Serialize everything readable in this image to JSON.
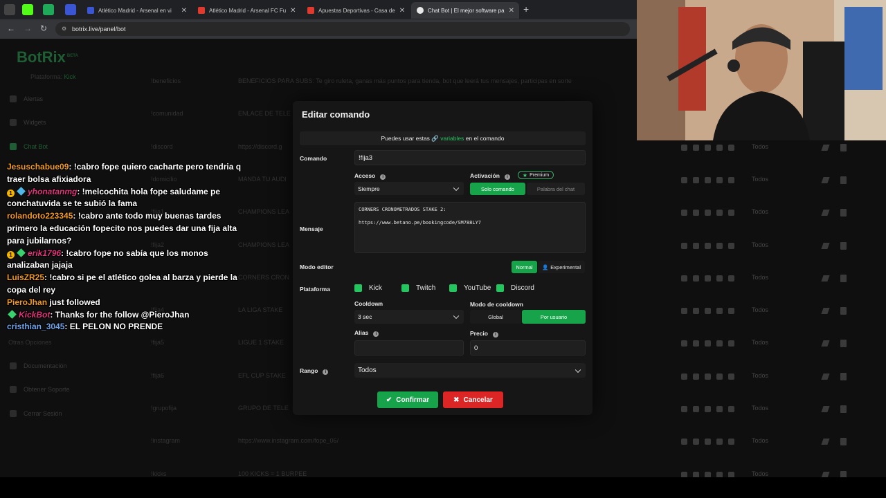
{
  "browser": {
    "tabs": [
      {
        "label": "Atlético Madrid - Arsenal en vi",
        "color": "#3a56d4"
      },
      {
        "label": "Atlético Madrid - Arsenal FC Fu",
        "color": "#e03a2f"
      },
      {
        "label": "Apuestas Deportivas - Casa de",
        "color": "#e03a2f"
      },
      {
        "label": "Chat Bot | El mejor software pa",
        "color": "#e8e8e8"
      }
    ],
    "url": "botrix.live/panel/bot"
  },
  "background": {
    "logo": "BotRix",
    "logo_badge": "BETA",
    "platform_label": "Plataforma:",
    "platform_value": "Kick",
    "sidebar": [
      {
        "label": "Alertas"
      },
      {
        "label": "Widgets"
      },
      {
        "label": "Chat Bot"
      }
    ],
    "sidebar_bottom_head": "Otras Opciones",
    "sidebar_bottom": [
      {
        "label": "Documentación"
      },
      {
        "label": "Obtener Soporte"
      },
      {
        "label": "Cerrar Sesión"
      }
    ],
    "commands": [
      {
        "name": "!beneficios",
        "text": "BENEFICIOS PARA SUBS: Te giro ruleta, ganas más puntos para tienda, bot que leerá tus mensajes, participas en sorte"
      },
      {
        "name": "!comunidad",
        "text": "ENLACE DE TELE"
      },
      {
        "name": "!discord",
        "text": "https://discord.g"
      },
      {
        "name": "!domicilio",
        "text": "MANDA TU AUDI"
      },
      {
        "name": "!fija1",
        "text": "CHAMPIONS LEA"
      },
      {
        "name": "!fija2",
        "text": "CHAMPIONS LEA"
      },
      {
        "name": "!fija3",
        "text": "CORNERS CRON"
      },
      {
        "name": "!fija4",
        "text": "LA LIGA STAKE"
      },
      {
        "name": "!fija5",
        "text": "LIGUE 1 STAKE"
      },
      {
        "name": "!fija6",
        "text": "EFL CUP STAKE"
      },
      {
        "name": "!grupofija",
        "text": "GRUPO DE TELE"
      },
      {
        "name": "!instagram",
        "text": "https://www.instagram.com/fope_06/"
      },
      {
        "name": "!kicks",
        "text": "100 KICKS = 1 BURPEE"
      }
    ],
    "rank_value": "Todos"
  },
  "chat": [
    {
      "user": "Jesuschabue09",
      "user_color": "orange",
      "badge": "",
      "msg": ": !cabro fope quiero cacharte pero tendria q traer bolsa afixiadora"
    },
    {
      "user": "yhonatanmg",
      "user_color": "pink",
      "badge": "1",
      "msg": ": !melcochita hola fope saludame pe conchatuvida se te subió la fama"
    },
    {
      "user": "rolandoto223345",
      "user_color": "orange",
      "badge": "",
      "msg": ": !cabro ante todo muy buenas tardes primero la educación fopecito nos puedes dar una fija alta para jubilarnos?"
    },
    {
      "user": "erik1796",
      "user_color": "pink",
      "badge": "1",
      "msg": ": !cabro fope no sabía que los monos analizaban jajaja"
    },
    {
      "user": "LuisZR25",
      "user_color": "orange",
      "badge": "",
      "msg": ": !cabro si pe el atlético golea al barza y pierde la copa del rey"
    },
    {
      "user": "PieroJhan",
      "user_color": "orange",
      "badge": "",
      "msg": " just followed"
    },
    {
      "user": "KickBot",
      "user_color": "pink",
      "badge": "",
      "msg": ": Thanks for the follow @PieroJhan"
    },
    {
      "user": "cristhian_3045",
      "user_color": "blue",
      "badge": "",
      "msg": ": EL PELON NO PRENDE"
    }
  ],
  "modal": {
    "title": "Editar comando",
    "hint_pre": "Puedes usar estas",
    "hint_link": "variables",
    "hint_post": "en el comando",
    "command_label": "Comando",
    "command_value": "!fija3",
    "access_label": "Acceso",
    "access_value": "Siempre",
    "activation_label": "Activación",
    "premium_label": "Premium",
    "activation_options": [
      "Solo comando",
      "Palabra del chat"
    ],
    "activation_selected": "Solo comando",
    "message_label": "Mensaje",
    "message_line1": "CORNERS CRONOMETRADOS STAKE 2:",
    "message_line2": "https://www.betano.pe/bookingcode/SM788LY7",
    "editor_label": "Modo editor",
    "editor_options": [
      "Normal",
      "Experimental"
    ],
    "platform_label": "Plataforma",
    "platforms": [
      {
        "label": "Kick",
        "checked": true
      },
      {
        "label": "Twitch",
        "checked": true
      },
      {
        "label": "YouTube",
        "checked": true
      },
      {
        "label": "Discord",
        "checked": true
      }
    ],
    "cooldown_label": "Cooldown",
    "cooldown_value": "3 sec",
    "cooldown_mode_label": "Modo de cooldown",
    "cooldown_modes": [
      "Global",
      "Por usuario"
    ],
    "alias_label": "Alias",
    "alias_value": "",
    "price_label": "Precio",
    "price_value": "0",
    "rank_label": "Rango",
    "rank_value": "Todos",
    "confirm_label": "Confirmar",
    "cancel_label": "Cancelar",
    "accent": "#16a34a",
    "danger": "#dc2626"
  }
}
